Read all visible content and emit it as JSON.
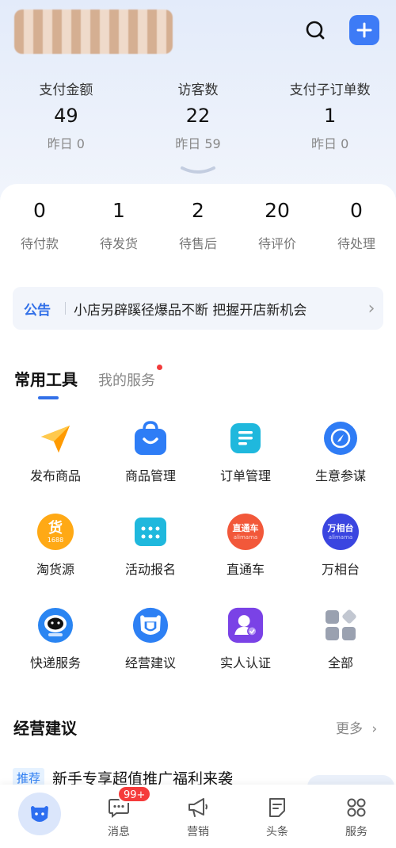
{
  "header": {
    "shop_name": "",
    "colors": {
      "accent": "#3d7bf6",
      "badge_red": "#f53b3b"
    }
  },
  "stats": [
    {
      "label": "支付金额",
      "value": "49",
      "sub": "昨日 0"
    },
    {
      "label": "访客数",
      "value": "22",
      "sub": "昨日 59"
    },
    {
      "label": "支付子订单数",
      "value": "1",
      "sub": "昨日 0"
    }
  ],
  "orders": [
    {
      "num": "0",
      "label": "待付款"
    },
    {
      "num": "1",
      "label": "待发货"
    },
    {
      "num": "2",
      "label": "待售后"
    },
    {
      "num": "20",
      "label": "待评价"
    },
    {
      "num": "0",
      "label": "待处理"
    }
  ],
  "notice": {
    "tag": "公告",
    "text": "小店另辟蹊径爆品不断 把握开店新机会"
  },
  "tabs": {
    "active": "常用工具",
    "inactive": "我的服务"
  },
  "tools": [
    {
      "name": "发布商品",
      "icon": "paper-plane-icon"
    },
    {
      "name": "商品管理",
      "icon": "shopping-bag-icon"
    },
    {
      "name": "订单管理",
      "icon": "order-list-icon"
    },
    {
      "name": "生意参谋",
      "icon": "compass-icon"
    },
    {
      "name": "淘货源",
      "icon": "taohuoyuan-1688-icon",
      "badge_text": "货",
      "badge_sub": "1688"
    },
    {
      "name": "活动报名",
      "icon": "calendar-icon"
    },
    {
      "name": "直通车",
      "icon": "zhitongche-icon",
      "badge_text": "直通车",
      "badge_sub": "alimama"
    },
    {
      "name": "万相台",
      "icon": "wanxiangtai-icon",
      "badge_text": "万相台",
      "badge_sub": "alimama"
    },
    {
      "name": "快递服务",
      "icon": "courier-robot-icon"
    },
    {
      "name": "经营建议",
      "icon": "cow-icon"
    },
    {
      "name": "实人认证",
      "icon": "person-verify-icon"
    },
    {
      "name": "全部",
      "icon": "grid-all-icon"
    }
  ],
  "section": {
    "title": "经营建议",
    "more": "更多"
  },
  "recommend": {
    "badge": "推荐",
    "title": "新手专享超值推广福利来袭"
  },
  "tabbar": {
    "items": [
      {
        "label": "",
        "icon": "home-cow-icon"
      },
      {
        "label": "消息",
        "icon": "message-icon"
      },
      {
        "label": "营销",
        "icon": "megaphone-icon"
      },
      {
        "label": "头条",
        "icon": "news-icon"
      },
      {
        "label": "服务",
        "icon": "services-grid-icon"
      }
    ],
    "message_badge": "99+"
  }
}
